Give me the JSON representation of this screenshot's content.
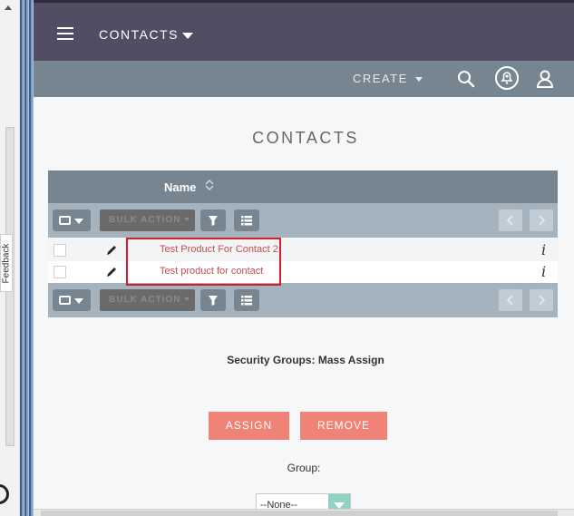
{
  "app": {
    "module_title": "CONTACTS",
    "create_label": "CREATE",
    "page_title": "CONTACTS"
  },
  "feedback_label": "Feedback",
  "list": {
    "columns": [
      {
        "label": "Name"
      }
    ],
    "bulk_action_label": "BULK ACTION",
    "rows": [
      {
        "name": "Test Product For Contact 2"
      },
      {
        "name": "Test product for contact"
      }
    ],
    "info_glyph": "i"
  },
  "security_groups": {
    "title": "Security Groups: Mass Assign",
    "assign_label": "ASSIGN",
    "remove_label": "REMOVE",
    "group_label": "Group:",
    "group_value": "--None--"
  },
  "colors": {
    "topbar": "#534d64",
    "subbar": "#778591",
    "accent_button": "#f08377",
    "link": "#c0504d",
    "highlight_border": "#d0202a"
  },
  "icons": [
    "hamburger-icon",
    "caret-down-icon",
    "search-icon",
    "bell-icon",
    "user-icon",
    "sort-icon",
    "filter-icon",
    "columns-icon",
    "pencil-icon",
    "info-icon"
  ]
}
